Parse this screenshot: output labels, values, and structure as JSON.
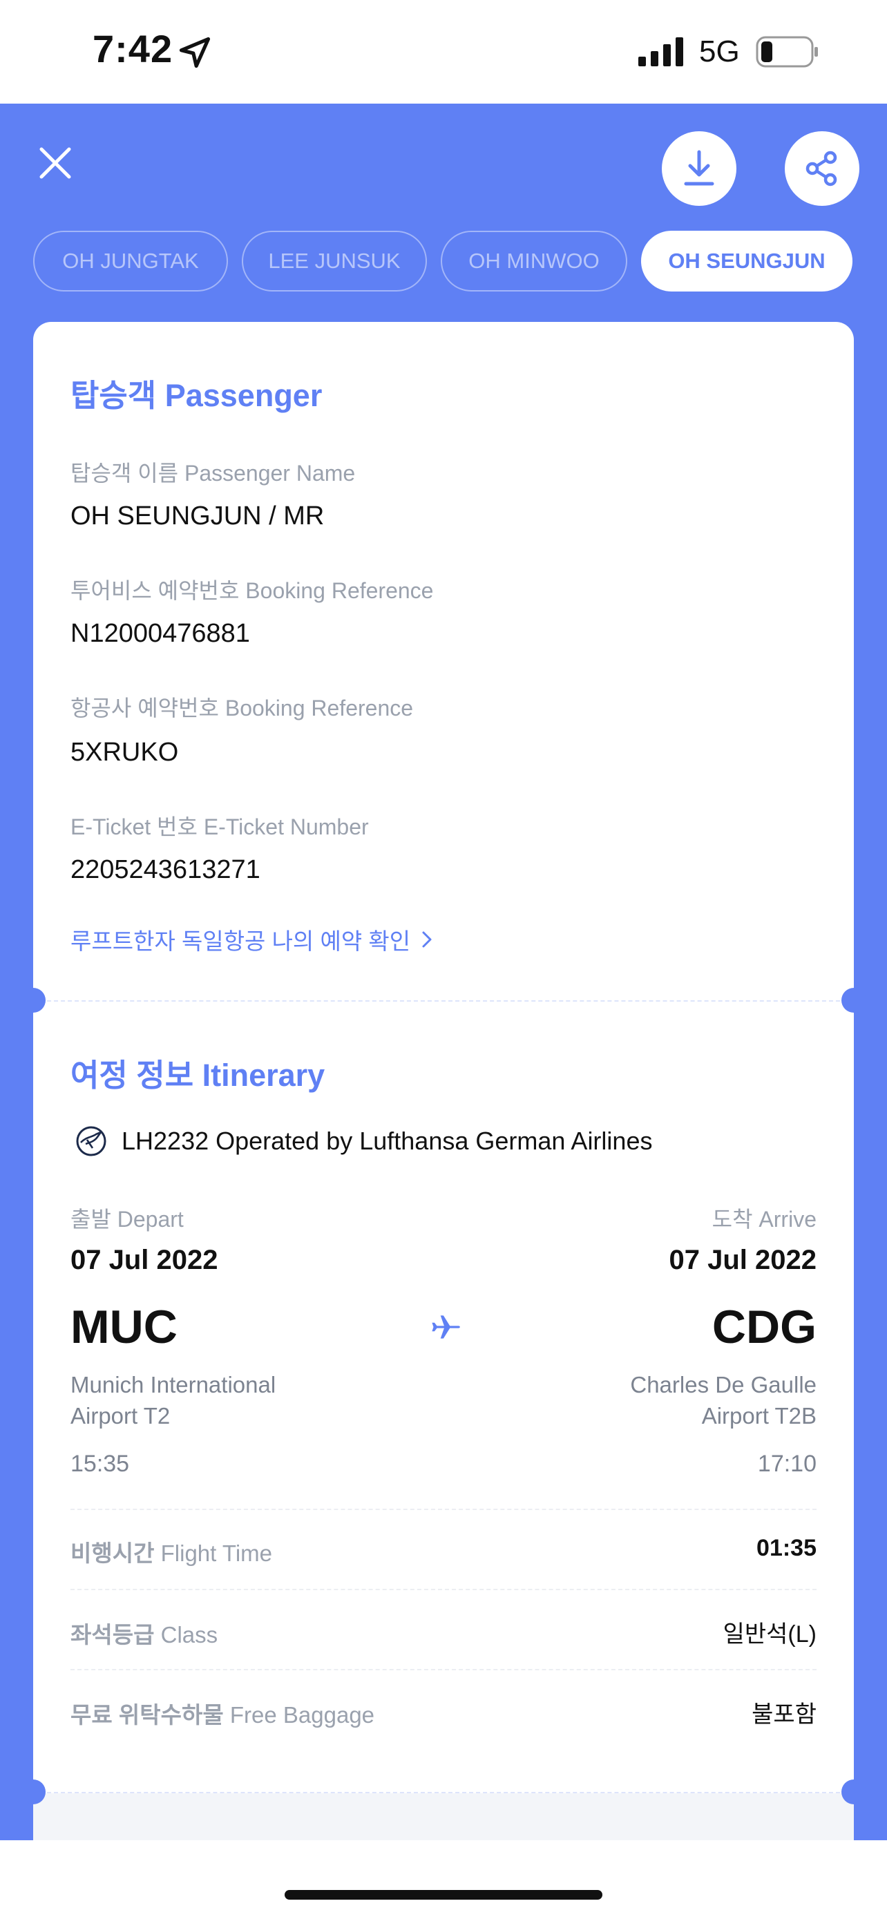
{
  "status_bar": {
    "time": "7:42",
    "network": "5G",
    "icons": [
      "location-arrow-icon",
      "signal-icon",
      "battery-icon"
    ]
  },
  "header": {
    "close_icon": "close-icon",
    "download_icon": "download-icon",
    "share_icon": "share-icon"
  },
  "passengers": {
    "tabs": [
      {
        "label": "OH JUNGTAK",
        "active": false
      },
      {
        "label": "LEE JUNSUK",
        "active": false
      },
      {
        "label": "OH MINWOO",
        "active": false
      },
      {
        "label": "OH SEUNGJUN",
        "active": true
      }
    ]
  },
  "passenger_section": {
    "title": "탑승객 Passenger",
    "name_label": "탑승객 이름 Passenger Name",
    "name_value": "OH SEUNGJUN / MR",
    "tourvis_ref_label": "투어비스 예약번호 Booking Reference",
    "tourvis_ref_value": "N12000476881",
    "airline_ref_label": "항공사 예약번호 Booking Reference",
    "airline_ref_value": "5XRUKO",
    "eticket_label": "E-Ticket 번호 E-Ticket Number",
    "eticket_value": "2205243613271",
    "link_text": "루프트한자 독일항공 나의 예약 확인"
  },
  "itinerary": {
    "title": "여정 정보 Itinerary",
    "flight_line": "LH2232 Operated by Lufthansa German Airlines",
    "airline_icon": "lufthansa-crane-icon",
    "depart": {
      "label": "출발 Depart",
      "date": "07 Jul 2022",
      "code": "MUC",
      "airport_line1": "Munich International",
      "airport_line2": "Airport T2",
      "time": "15:35"
    },
    "arrive": {
      "label": "도착 Arrive",
      "date": "07 Jul 2022",
      "code": "CDG",
      "airport_line1": "Charles De Gaulle",
      "airport_line2": "Airport T2B",
      "time": "17:10"
    },
    "details": [
      {
        "label_ko": "비행시간",
        "label_en": "Flight Time",
        "value": "01:35"
      },
      {
        "label_ko": "좌석등급",
        "label_en": "Class",
        "value": "일반석(L)"
      },
      {
        "label_ko": "무료 위탁수하물",
        "label_en": "Free Baggage",
        "value": "불포함"
      }
    ]
  },
  "colors": {
    "accent": "#5f80f4",
    "text": "#111111",
    "muted": "#9aa1ad"
  }
}
